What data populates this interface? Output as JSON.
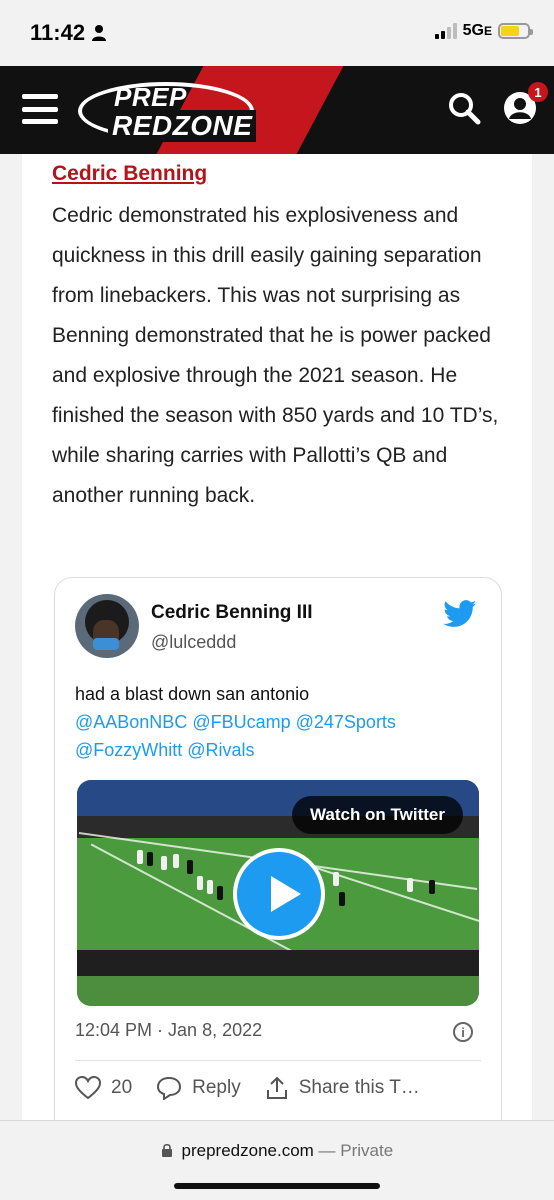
{
  "status_bar": {
    "time": "11:42",
    "network": "5G",
    "network_suffix": "E",
    "battery_color": "#f6d21a"
  },
  "header": {
    "logo_line1": "PREP",
    "logo_line2": "REDZONE",
    "notification_count": "1",
    "brand_color": "#c4161c"
  },
  "article": {
    "player_link": "Cedric Benning",
    "body": "Cedric demonstrated his explosiveness and quickness in this drill easily gaining separation from linebackers. This was not surprising as Benning demonstrated that he is power packed and explosive through the 2021 season. He finished the season with 850 yards and 10 TD’s, while sharing carries with Pallotti’s QB and another running back."
  },
  "tweet": {
    "display_name": "Cedric Benning III",
    "handle": "@lulceddd",
    "text": "had a blast down san antonio",
    "mentions_line1": "@AABonNBC @FBUcamp @247Sports",
    "mentions_line2": "@FozzyWhitt @Rivals",
    "watch_label": "Watch on Twitter",
    "date": "12:04 PM · Jan 8, 2022",
    "like_count": "20",
    "reply_label": "Reply",
    "share_label": "Share this T…",
    "link_color": "#1d9bf0"
  },
  "browser": {
    "domain": "prepredzone.com",
    "separator": " — ",
    "mode": "Private"
  }
}
